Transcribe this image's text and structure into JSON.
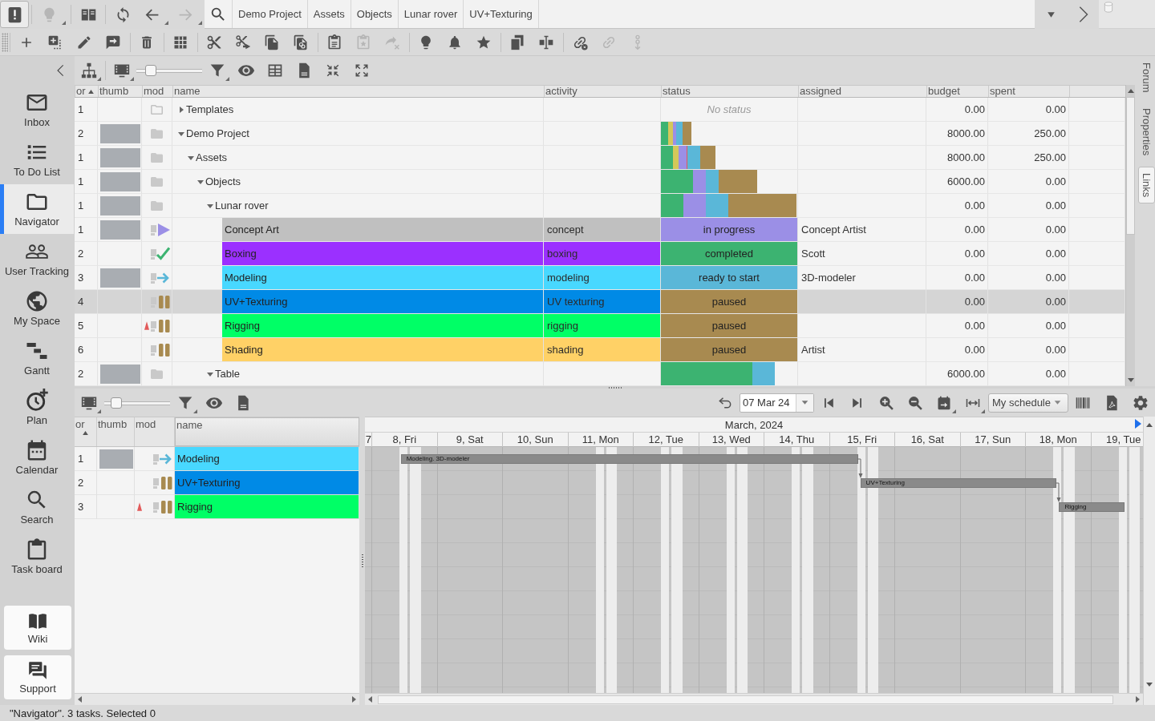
{
  "top_bar": {
    "tools": [
      {
        "selected": true,
        "disabled": false
      },
      {
        "selected": false,
        "disabled": true
      },
      {
        "selected": false,
        "disabled": false
      },
      {
        "selected": false,
        "disabled": false
      },
      {
        "selected": false,
        "disabled": false
      },
      {
        "selected": false,
        "disabled": true
      }
    ],
    "breadcrumbs": [
      {
        "label": "Demo Project"
      },
      {
        "label": "Assets"
      },
      {
        "label": "Objects"
      },
      {
        "label": "Lunar rover"
      },
      {
        "label": "UV+Texturing"
      }
    ]
  },
  "toolbar": [
    {
      "disabled": false
    },
    {
      "disabled": false
    },
    {
      "disabled": false
    },
    {
      "disabled": false
    },
    {
      "disabled": false
    },
    {
      "disabled": false
    },
    {
      "disabled": false
    },
    {
      "disabled": false
    },
    {
      "disabled": false
    },
    {
      "disabled": false
    },
    {
      "disabled": false
    },
    {
      "disabled": true
    },
    {
      "disabled": true
    },
    {
      "disabled": false
    },
    {
      "disabled": false
    },
    {
      "disabled": false
    },
    {
      "disabled": false
    },
    {
      "disabled": false
    },
    {
      "disabled": false
    },
    {
      "disabled": true
    },
    {
      "disabled": true
    }
  ],
  "sidebar": {
    "items": [
      {
        "label": "Inbox",
        "selected": false
      },
      {
        "label": "To Do List",
        "selected": false
      },
      {
        "label": "Navigator",
        "selected": true
      },
      {
        "label": "User Tracking",
        "selected": false
      },
      {
        "label": "My Space",
        "selected": false
      },
      {
        "label": "Gantt",
        "selected": false
      },
      {
        "label": "Plan",
        "selected": false
      },
      {
        "label": "Calendar",
        "selected": false
      },
      {
        "label": "Search",
        "selected": false
      },
      {
        "label": "Task board",
        "selected": false
      }
    ],
    "buttons": [
      {
        "label": "Wiki"
      },
      {
        "label": "Support"
      }
    ]
  },
  "navigator": {
    "toolbar": {
      "thumbnail_size": {
        "level": 0.22
      }
    },
    "table": {
      "columns": [
        {
          "label": "or",
          "sorted": true
        },
        {
          "label": "thumb",
          "sorted": false
        },
        {
          "label": "mod",
          "sorted": false
        },
        {
          "label": "name",
          "sorted": false
        },
        {
          "label": "activity",
          "sorted": false
        },
        {
          "label": "status",
          "sorted": false
        },
        {
          "label": "assigned",
          "sorted": false
        },
        {
          "label": "budget",
          "sorted": false
        },
        {
          "label": "spent",
          "sorted": false
        }
      ],
      "rows": [
        {
          "kind": "emptyfolder",
          "order": "1",
          "thumbnail": false,
          "alert": false,
          "name": "Templates",
          "expanded": false,
          "selected": false,
          "status_text": "No status",
          "budget": "0.00",
          "spent": "0.00"
        },
        {
          "kind": "folder",
          "order": "2",
          "thumbnail": true,
          "alert": false,
          "name": "Demo Project",
          "expanded": true,
          "selected": false,
          "status_bar": [
            {
              "color": "#3cb371"
            },
            {
              "color": "#d4c85a"
            },
            {
              "color": "#9b8fe6"
            },
            {
              "color": "#5ab7d8"
            },
            {
              "color": "#a88a50"
            }
          ],
          "budget": "8000.00",
          "spent": "250.00",
          "children": [
            {
              "kind": "folder",
              "order": "1",
              "thumbnail": true,
              "alert": false,
              "name": "Assets",
              "expanded": true,
              "selected": false,
              "status_bar": [
                {
                  "color": "#3cb371"
                },
                {
                  "color": "#d4c85a"
                },
                {
                  "color": "#9b8fe6"
                },
                {
                  "color": "#e05a5a"
                },
                {
                  "color": "#5ab7d8"
                },
                {
                  "color": "#a88a50"
                }
              ],
              "budget": "8000.00",
              "spent": "250.00",
              "children": [
                {
                  "kind": "folder",
                  "order": "1",
                  "thumbnail": true,
                  "alert": false,
                  "name": "Objects",
                  "expanded": true,
                  "selected": false,
                  "status_bar": [
                    {
                      "color": "#3cb371"
                    },
                    {
                      "color": "#9b8fe6"
                    },
                    {
                      "color": "#5ab7d8"
                    },
                    {
                      "color": "#a88a50"
                    }
                  ],
                  "budget": "6000.00",
                  "spent": "0.00",
                  "children": [
                    {
                      "kind": "folder",
                      "order": "1",
                      "thumbnail": true,
                      "alert": false,
                      "name": "Lunar rover",
                      "expanded": true,
                      "selected": false,
                      "status_bar": [
                        {
                          "color": "#3cb371"
                        },
                        {
                          "color": "#9b8fe6"
                        },
                        {
                          "color": "#5ab7d8"
                        },
                        {
                          "color": "#a88a50"
                        }
                      ],
                      "budget": "0.00",
                      "spent": "0.00",
                      "children": [
                        {
                          "kind": "task",
                          "order": "1",
                          "thumbnail": true,
                          "alert": false,
                          "name": "Concept Art",
                          "color": "#c0c0c0",
                          "activity": "concept",
                          "status": {
                            "label": "in progress",
                            "kind": "progress",
                            "color": "#9b8fe6"
                          },
                          "assigned": "Concept Artist",
                          "selected": false,
                          "budget": "0.00",
                          "spent": "0.00"
                        },
                        {
                          "kind": "task",
                          "order": "2",
                          "thumbnail": false,
                          "alert": false,
                          "name": "Boxing",
                          "color": "#9b30ff",
                          "activity": "boxing",
                          "status": {
                            "label": "completed",
                            "kind": "done",
                            "color": "#3cb371"
                          },
                          "assigned": "Scott",
                          "selected": false,
                          "budget": "0.00",
                          "spent": "0.00"
                        },
                        {
                          "kind": "task",
                          "order": "3",
                          "thumbnail": true,
                          "alert": false,
                          "name": "Modeling",
                          "color": "#48d8ff",
                          "activity": "modeling",
                          "status": {
                            "label": "ready to start",
                            "kind": "ready",
                            "color": "#5ab7d8"
                          },
                          "assigned": "3D-modeler",
                          "selected": false,
                          "budget": "0.00",
                          "spent": "0.00"
                        },
                        {
                          "kind": "task",
                          "order": "4",
                          "thumbnail": false,
                          "alert": false,
                          "name": "UV+Texturing",
                          "color": "#008ae6",
                          "activity": "UV texturing",
                          "status": {
                            "label": "paused",
                            "kind": "paused",
                            "color": "#a88a50"
                          },
                          "selected": true,
                          "budget": "0.00",
                          "spent": "0.00"
                        },
                        {
                          "kind": "task",
                          "order": "5",
                          "thumbnail": false,
                          "alert": true,
                          "name": "Rigging",
                          "color": "#00ff66",
                          "activity": "rigging",
                          "status": {
                            "label": "paused",
                            "kind": "paused",
                            "color": "#a88a50"
                          },
                          "selected": false,
                          "budget": "0.00",
                          "spent": "0.00"
                        },
                        {
                          "kind": "task",
                          "order": "6",
                          "thumbnail": false,
                          "alert": false,
                          "name": "Shading",
                          "color": "#ffd166",
                          "activity": "shading",
                          "status": {
                            "label": "paused",
                            "kind": "paused",
                            "color": "#a88a50"
                          },
                          "assigned": "Artist",
                          "selected": false,
                          "budget": "0.00",
                          "spent": "0.00"
                        }
                      ]
                    },
                    {
                      "kind": "folder",
                      "order": "2",
                      "thumbnail": true,
                      "alert": false,
                      "name": "Table",
                      "expanded": true,
                      "selected": false,
                      "status_bar": [
                        {
                          "color": "#3cb371"
                        },
                        {
                          "color": "#5ab7d8"
                        }
                      ],
                      "budget": "6000.00",
                      "spent": "0.00"
                    }
                  ]
                }
              ]
            }
          ]
        }
      ]
    }
  },
  "side_tabs": [
    {
      "label": "Forum",
      "selected": false
    },
    {
      "label": "Properties",
      "selected": false
    },
    {
      "label": "Links",
      "selected": true
    }
  ],
  "schedule": {
    "toolbar": {
      "thumbnail_size": {
        "level": 0.18
      },
      "date": "07 Mar 24",
      "view": "My schedule"
    },
    "table": {
      "columns": [
        {
          "label": "or",
          "sorted": true
        },
        {
          "label": "thumb",
          "sorted": false
        },
        {
          "label": "mod",
          "sorted": false
        },
        {
          "label": "name",
          "sorted": false
        }
      ],
      "rows": [
        {
          "order": "1",
          "thumbnail": true,
          "alert": false,
          "name": "Modeling",
          "color": "#48d8ff",
          "status": {
            "kind": "ready",
            "color": "#5ab7d8"
          },
          "selected": false
        },
        {
          "order": "2",
          "thumbnail": false,
          "alert": false,
          "name": "UV+Texturing",
          "color": "#008ae6",
          "status": {
            "kind": "paused",
            "color": "#a88a50"
          },
          "selected": false
        },
        {
          "order": "3",
          "thumbnail": false,
          "alert": true,
          "name": "Rigging",
          "color": "#00ff66",
          "status": {
            "kind": "paused",
            "color": "#a88a50"
          },
          "selected": false
        }
      ]
    },
    "gantt": {
      "month": "March, 2024",
      "days": [
        {
          "label": "7"
        },
        {
          "label": "8, Fri",
          "weekend": false
        },
        {
          "label": "9, Sat",
          "weekend": true
        },
        {
          "label": "10, Sun",
          "weekend": true
        },
        {
          "label": "11, Mon",
          "weekend": false
        },
        {
          "label": "12, Tue",
          "weekend": false
        },
        {
          "label": "13, Wed",
          "weekend": false
        },
        {
          "label": "14, Thu",
          "weekend": false
        },
        {
          "label": "15, Fri",
          "weekend": false
        },
        {
          "label": "16, Sat",
          "weekend": true
        },
        {
          "label": "17, Sun",
          "weekend": true
        },
        {
          "label": "18, Mon",
          "weekend": false
        },
        {
          "label": "19, Tue",
          "weekend": false
        }
      ],
      "bars": [
        {
          "label": "Modeling. 3D-modeler"
        },
        {
          "label": "UV+Texturing"
        },
        {
          "label": "Rigging"
        }
      ]
    }
  },
  "status_bar": "\"Navigator\". 3 tasks. Selected 0"
}
